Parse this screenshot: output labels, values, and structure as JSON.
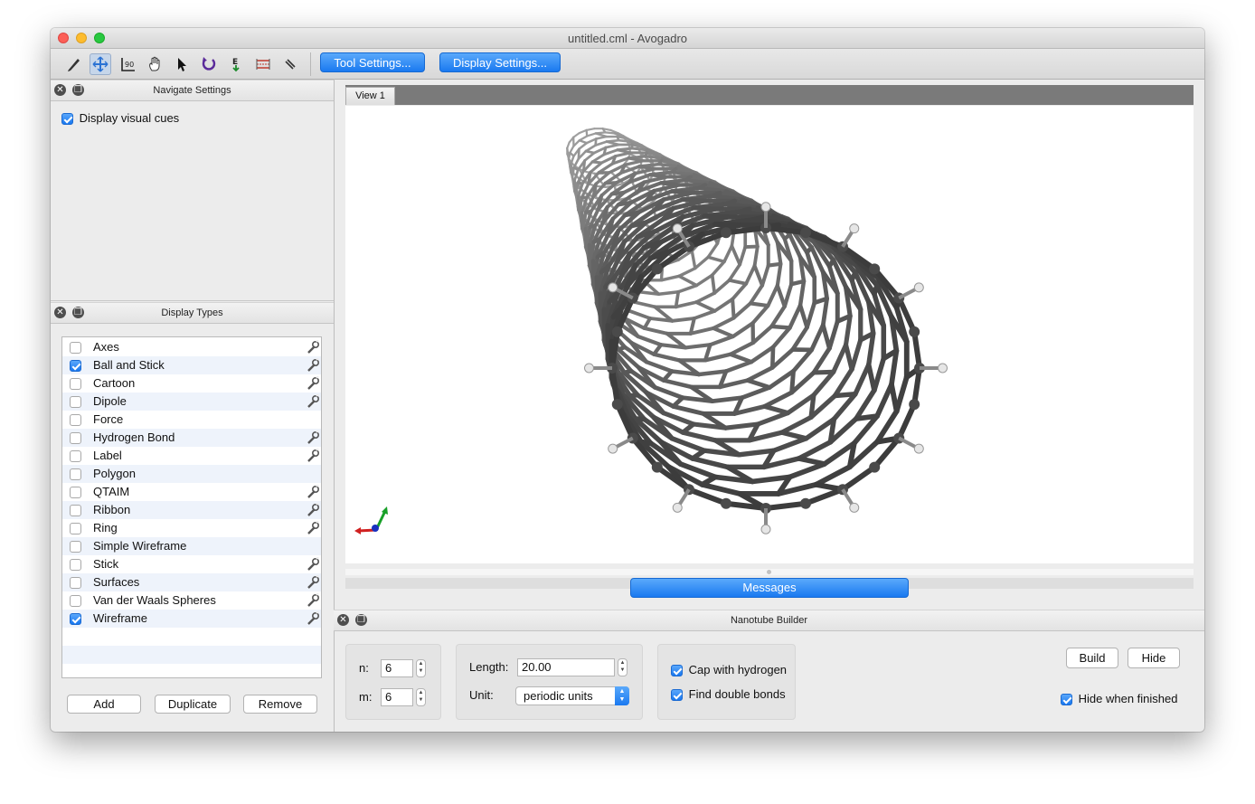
{
  "window": {
    "title": "untitled.cml - Avogadro"
  },
  "toolbar": {
    "tools": [
      {
        "name": "draw-tool-icon"
      },
      {
        "name": "navigate-tool-icon"
      },
      {
        "name": "measure-tool-icon"
      },
      {
        "name": "manipulate-tool-icon"
      },
      {
        "name": "select-tool-icon"
      },
      {
        "name": "rotate-tool-icon"
      },
      {
        "name": "auto-optimize-tool-icon"
      },
      {
        "name": "align-tool-icon"
      },
      {
        "name": "bond-centric-tool-icon"
      }
    ],
    "tool_settings": "Tool Settings...",
    "display_settings": "Display Settings..."
  },
  "navigate": {
    "title": "Navigate Settings",
    "visual_cues_label": "Display visual cues",
    "visual_cues_checked": true
  },
  "display_types": {
    "title": "Display Types",
    "items": [
      {
        "label": "Axes",
        "checked": false,
        "settings": true
      },
      {
        "label": "Ball and Stick",
        "checked": true,
        "settings": true
      },
      {
        "label": "Cartoon",
        "checked": false,
        "settings": true
      },
      {
        "label": "Dipole",
        "checked": false,
        "settings": true
      },
      {
        "label": "Force",
        "checked": false,
        "settings": false
      },
      {
        "label": "Hydrogen Bond",
        "checked": false,
        "settings": true
      },
      {
        "label": "Label",
        "checked": false,
        "settings": true
      },
      {
        "label": "Polygon",
        "checked": false,
        "settings": false
      },
      {
        "label": "QTAIM",
        "checked": false,
        "settings": true
      },
      {
        "label": "Ribbon",
        "checked": false,
        "settings": true
      },
      {
        "label": "Ring",
        "checked": false,
        "settings": true
      },
      {
        "label": "Simple Wireframe",
        "checked": false,
        "settings": false
      },
      {
        "label": "Stick",
        "checked": false,
        "settings": true
      },
      {
        "label": "Surfaces",
        "checked": false,
        "settings": true
      },
      {
        "label": "Van der Waals Spheres",
        "checked": false,
        "settings": true
      },
      {
        "label": "Wireframe",
        "checked": true,
        "settings": true
      }
    ],
    "add": "Add",
    "duplicate": "Duplicate",
    "remove": "Remove"
  },
  "view": {
    "tab": "View 1",
    "messages": "Messages"
  },
  "nanotube": {
    "title": "Nanotube Builder",
    "n_label": "n:",
    "n_value": "6",
    "m_label": "m:",
    "m_value": "6",
    "length_label": "Length:",
    "length_value": "20.00",
    "unit_label": "Unit:",
    "unit_value": "periodic units",
    "cap_label": "Cap with hydrogen",
    "cap_checked": true,
    "double_label": "Find double bonds",
    "double_checked": true,
    "build": "Build",
    "hide": "Hide",
    "hide_when_finished": "Hide when finished",
    "hide_when_finished_checked": true
  },
  "colors": {
    "accent": "#1a79f0",
    "molecule": "#4a4a4a",
    "hydrogen": "#e6e6e6"
  }
}
